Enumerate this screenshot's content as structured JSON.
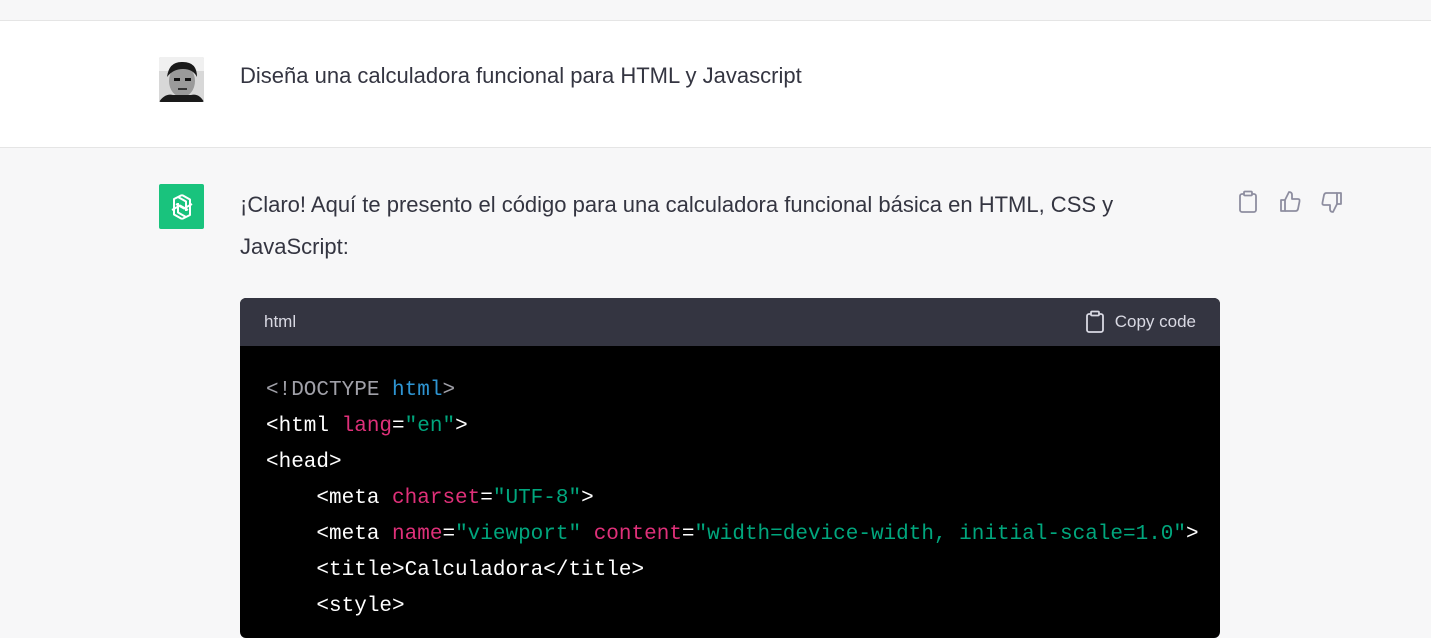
{
  "user_message": {
    "text": "Diseña una calculadora funcional para HTML y Javascript"
  },
  "assistant_message": {
    "text_line1": "¡Claro! Aquí te presento el código para una calculadora funcional básica en HTML, CSS y",
    "text_line2": "JavaScript:",
    "action_icons": [
      "clipboard-icon",
      "thumbs-up-icon",
      "thumbs-down-icon"
    ]
  },
  "code_block": {
    "language": "html",
    "copy_label": "Copy code",
    "lines": [
      [
        {
          "t": "<!DOCTYPE ",
          "c": "doc"
        },
        {
          "t": "html",
          "c": "kw"
        },
        {
          "t": ">",
          "c": "doc"
        }
      ],
      [
        {
          "t": "<html ",
          "c": "tag"
        },
        {
          "t": "lang",
          "c": "attr"
        },
        {
          "t": "=",
          "c": "tag"
        },
        {
          "t": "\"en\"",
          "c": "str"
        },
        {
          "t": ">",
          "c": "tag"
        }
      ],
      [
        {
          "t": "<head>",
          "c": "tag"
        }
      ],
      [
        {
          "t": "    <meta ",
          "c": "tag"
        },
        {
          "t": "charset",
          "c": "attr"
        },
        {
          "t": "=",
          "c": "tag"
        },
        {
          "t": "\"UTF-8\"",
          "c": "str"
        },
        {
          "t": ">",
          "c": "tag"
        }
      ],
      [
        {
          "t": "    <meta ",
          "c": "tag"
        },
        {
          "t": "name",
          "c": "attr"
        },
        {
          "t": "=",
          "c": "tag"
        },
        {
          "t": "\"viewport\"",
          "c": "str"
        },
        {
          "t": " ",
          "c": "tag"
        },
        {
          "t": "content",
          "c": "attr"
        },
        {
          "t": "=",
          "c": "tag"
        },
        {
          "t": "\"width=device-width, initial-scale=1.0\"",
          "c": "str"
        },
        {
          "t": ">",
          "c": "tag"
        }
      ],
      [
        {
          "t": "    <title>Calculadora</title>",
          "c": "tag"
        }
      ],
      [
        {
          "t": "    <style>",
          "c": "tag"
        }
      ]
    ]
  },
  "colors": {
    "bot_avatar_bg": "#19c37d",
    "code_bg": "#000000",
    "code_header_bg": "#343541",
    "syntax_attr": "#df3079",
    "syntax_string": "#00a67d",
    "syntax_keyword": "#2e95d3"
  }
}
